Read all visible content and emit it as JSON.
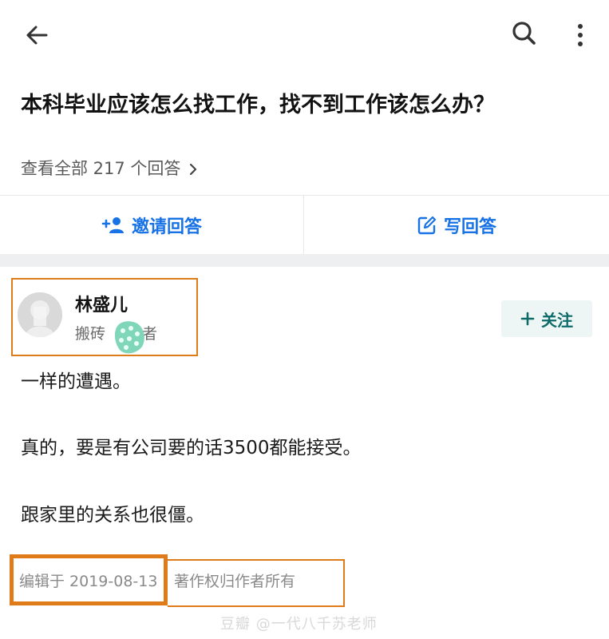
{
  "topbar": {
    "back_icon": "arrow-left-icon",
    "search_icon": "search-icon",
    "more_icon": "more-vertical-icon"
  },
  "question": {
    "title": "本科毕业应该怎么找工作，找不到工作该怎么办？",
    "view_all": "查看全部 217 个回答"
  },
  "actions": {
    "invite_label": "邀请回答",
    "write_label": "写回答",
    "accent_color": "#1772e6"
  },
  "answer": {
    "author_name": "林盛儿",
    "author_bio_prefix": "搬砖",
    "author_bio_suffix": "者",
    "follow_label": "关注",
    "paragraphs": [
      "一样的遭遇。",
      "真的，要是有公司要的话3500都能接受。",
      "跟家里的关系也很僵。"
    ],
    "edit_date": "编辑于 2019-08-13",
    "copyright": "著作权归作者所有"
  },
  "watermark": {
    "text": "豆瓣 @一代八千苏老师"
  },
  "colors": {
    "highlight_box": "#e07b1a",
    "follow_text": "#0d6b6a",
    "follow_bg": "#eef6f5"
  }
}
